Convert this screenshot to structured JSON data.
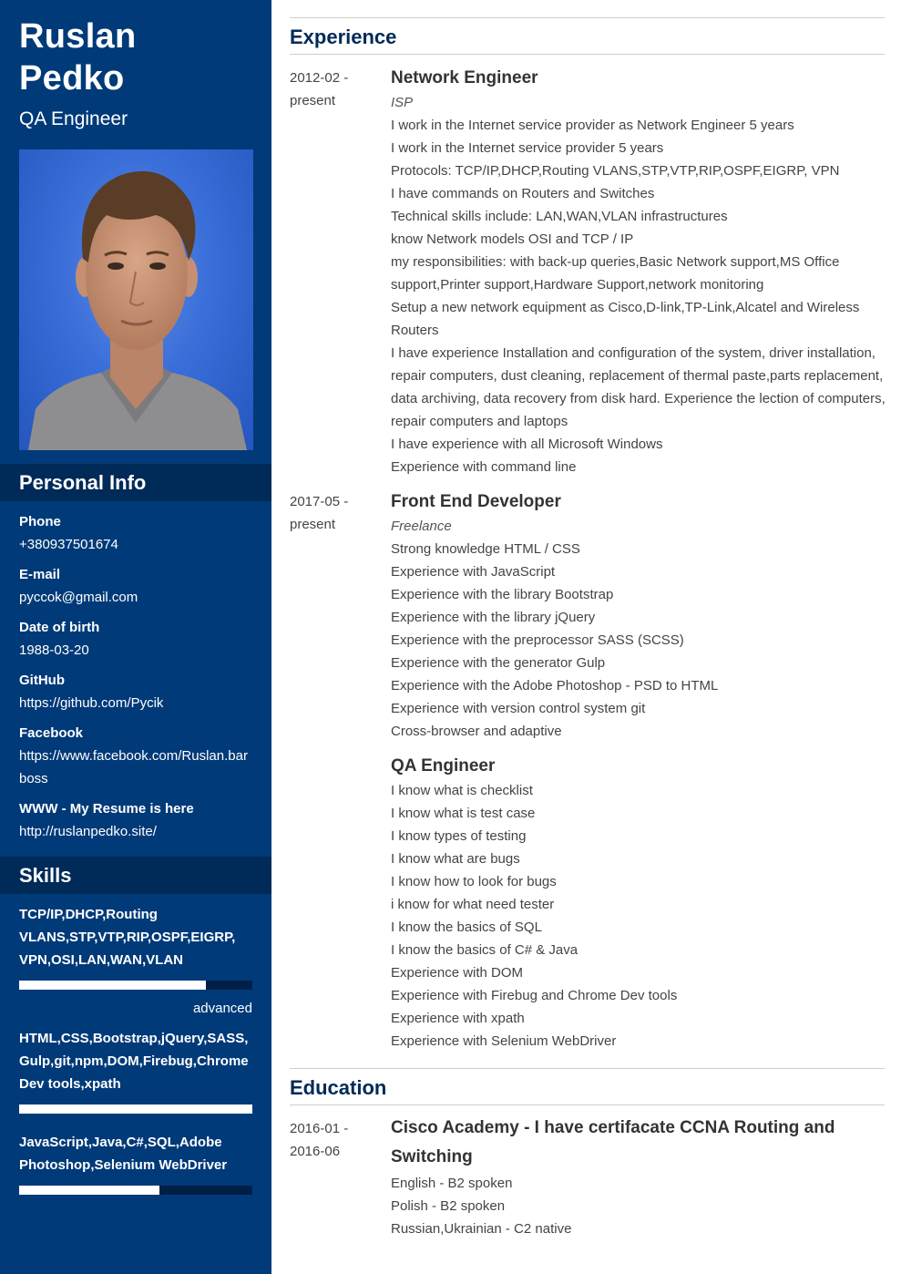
{
  "profile": {
    "first_name": "Ruslan",
    "last_name": "Pedko",
    "title": "QA Engineer",
    "photo": "portrait-photo"
  },
  "personal_info": {
    "heading": "Personal Info",
    "items": [
      {
        "label": "Phone",
        "value": "+380937501674"
      },
      {
        "label": "E-mail",
        "value": "pyccok@gmail.com"
      },
      {
        "label": "Date of birth",
        "value": "1988-03-20"
      },
      {
        "label": "GitHub",
        "value": "https://github.com/Pycik"
      },
      {
        "label": "Facebook",
        "value": "https://www.facebook.com/Ruslan.barboss"
      },
      {
        "label": "WWW - My Resume is here",
        "value": "http://ruslanpedko.site/"
      }
    ]
  },
  "skills": {
    "heading": "Skills",
    "items": [
      {
        "name": "TCP/IP,DHCP,Routing VLANS,STP,VTP,RIP,OSPF,EIGRP, VPN,OSI,LAN,WAN,VLAN",
        "level": 0.8,
        "level_label": "advanced"
      },
      {
        "name": "HTML,CSS,Bootstrap,jQuery,SASS, Gulp,git,npm,DOM,Firebug,Chrome Dev tools,xpath",
        "level": 1.0
      },
      {
        "name": "JavaScript,Java,C#,SQL,Adobe Photoshop,Selenium WebDriver",
        "level": 0.6
      }
    ]
  },
  "experience": {
    "heading": "Experience",
    "entries": [
      {
        "date_start": "2012-02 -",
        "date_end": "present",
        "title": "Network Engineer",
        "company": "ISP",
        "lines": [
          "I work in the Internet service provider as Network Engineer 5 years",
          "I work in the Internet service provider 5 years",
          "Protocols: TCP/IP,DHCP,Routing VLANS,STP,VTP,RIP,OSPF,EIGRP, VPN",
          "I have commands on Routers and Switches",
          "Technical skills include: LAN,WAN,VLAN infrastructures",
          "know Network models OSI and TCP / IP",
          "my responsibilities: with back-up queries,Basic Network support,MS Office support,Printer support,Hardware Support,network monitoring",
          "Setup a new network equipment as Cisco,D-link,TP-Link,Alcatel and Wireless Routers",
          "I have experience Installation and configuration of the system, driver installation, repair computers, dust cleaning, replacement of thermal paste,parts replacement, data archiving, data recovery from disk hard. Experience the lection of computers, repair computers and laptops",
          "I have experience with all Microsoft Windows",
          "Experience with command line"
        ]
      },
      {
        "date_start": "2017-05 -",
        "date_end": "present",
        "title": "Front End Developer",
        "company": "Freelance",
        "lines": [
          "Strong knowledge HTML / CSS",
          "Experience with JavaScript",
          "Experience with the library Bootstrap",
          "Experience with the library jQuery",
          "Experience with the preprocessor SASS (SCSS)",
          "Experience with the generator Gulp",
          "Experience with the Adobe Photoshop - PSD to HTML",
          "Experience with version control system git",
          "Cross-browser and adaptive"
        ]
      },
      {
        "title": "QA Engineer",
        "lines": [
          "I know what is checklist",
          "I know what is test case",
          "I know types of testing",
          "I know what are bugs",
          "I know how to look for bugs",
          "i know for what need tester",
          "I know the basics of SQL",
          "I know the basics of C# & Java",
          "Experience with DOM",
          "Experience with Firebug and Chrome Dev tools",
          "Experience with xpath",
          "Experience with Selenium WebDriver"
        ]
      }
    ]
  },
  "education": {
    "heading": "Education",
    "entries": [
      {
        "date_start": "2016-01 -",
        "date_end": "2016-06",
        "title": "Cisco Academy - I have certifacate CCNA Routing and Switching",
        "lines": [
          "English - B2 spoken",
          "Polish - B2 spoken",
          "Russian,Ukrainian - C2 native"
        ]
      }
    ]
  }
}
